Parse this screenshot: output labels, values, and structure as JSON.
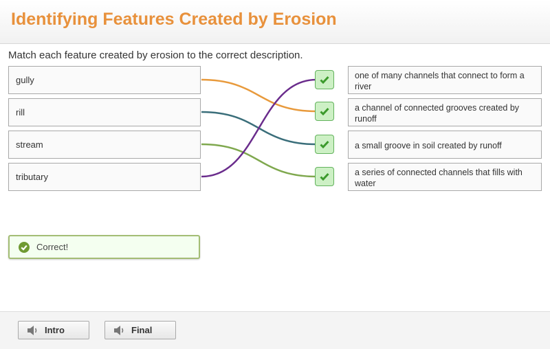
{
  "header": {
    "title": "Identifying Features Created by Erosion"
  },
  "instructions": "Match each feature created by erosion to the correct description.",
  "terms": [
    {
      "label": "gully"
    },
    {
      "label": "rill"
    },
    {
      "label": "stream"
    },
    {
      "label": "tributary"
    }
  ],
  "descriptions": [
    {
      "label": "one of many channels that connect to form a river",
      "status": "correct"
    },
    {
      "label": "a channel of connected grooves created by runoff",
      "status": "correct"
    },
    {
      "label": "a small groove in soil created by runoff",
      "status": "correct"
    },
    {
      "label": "a series of connected channels that fills with water",
      "status": "correct"
    }
  ],
  "matches": [
    {
      "term": "gully",
      "description_index": 1,
      "color": "#e89a3c"
    },
    {
      "term": "rill",
      "description_index": 2,
      "color": "#3a6e7a"
    },
    {
      "term": "stream",
      "description_index": 3,
      "color": "#7fa84e"
    },
    {
      "term": "tributary",
      "description_index": 0,
      "color": "#6a2c8c"
    }
  ],
  "feedback": {
    "text": "Correct!",
    "icon": "check-circle-icon",
    "color": "#6f9a32"
  },
  "footer": {
    "buttons": [
      {
        "label": "Intro",
        "icon": "speaker-icon"
      },
      {
        "label": "Final",
        "icon": "speaker-icon"
      }
    ]
  }
}
